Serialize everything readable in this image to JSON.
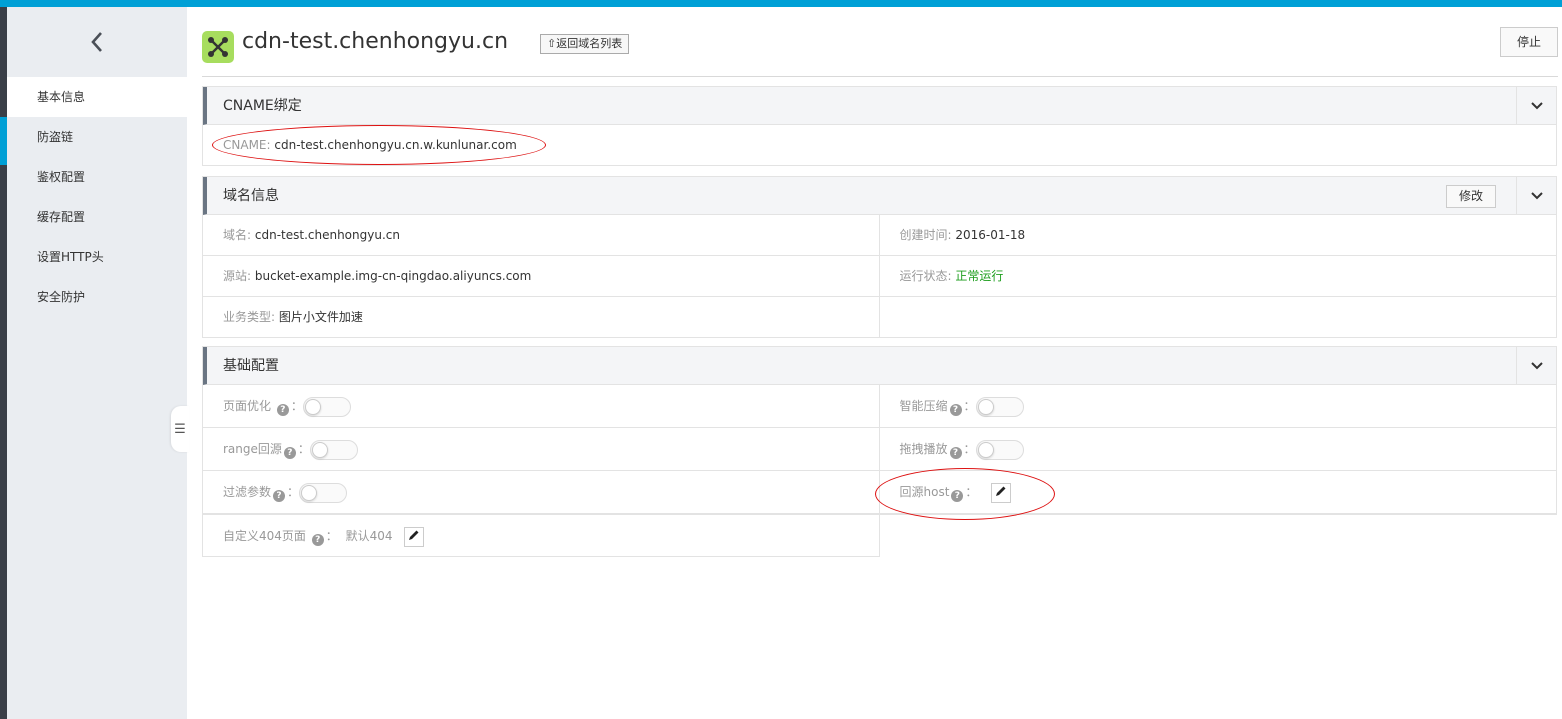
{
  "colors": {
    "accent": "#00a0d6",
    "status_green": "#1e9e1e",
    "annotation_red": "#dd1111",
    "logo_green": "#a7dd5e"
  },
  "sidebar": {
    "back_icon": "chevron-left-icon",
    "items": [
      {
        "label": "基本信息",
        "active": true
      },
      {
        "label": "防盗链"
      },
      {
        "label": "鉴权配置"
      },
      {
        "label": "缓存配置"
      },
      {
        "label": "设置HTTP头"
      },
      {
        "label": "安全防护"
      }
    ]
  },
  "header": {
    "logo_icon": "cdn-node-icon",
    "domain": "cdn-test.chenhongyu.cn",
    "back_to_list": "返回域名列表",
    "stop_button": "停止"
  },
  "cname_panel": {
    "title": "CNAME绑定",
    "cname_label": "CNAME:",
    "cname_value": "cdn-test.chenhongyu.cn.w.kunlunar.com"
  },
  "domain_panel": {
    "title": "域名信息",
    "edit_button": "修改",
    "domain_label": "域名:",
    "domain_value": "cdn-test.chenhongyu.cn",
    "created_label": "创建时间:",
    "created_value": "2016-01-18",
    "origin_label": "源站:",
    "origin_value": "bucket-example.img-cn-qingdao.aliyuncs.com",
    "status_label": "运行状态:",
    "status_value": "正常运行",
    "type_label": "业务类型:",
    "type_value": "图片小文件加速"
  },
  "config_panel": {
    "title": "基础配置",
    "page_opt_label": "页面优化",
    "smart_compress_label": "智能压缩",
    "range_label": "range回源",
    "drag_play_label": "拖拽播放",
    "filter_params_label": "过滤参数",
    "origin_host_label": "回源host",
    "custom404_label": "自定义404页面",
    "custom404_value": "默认404",
    "colon": "：",
    "help_mark": "?"
  }
}
